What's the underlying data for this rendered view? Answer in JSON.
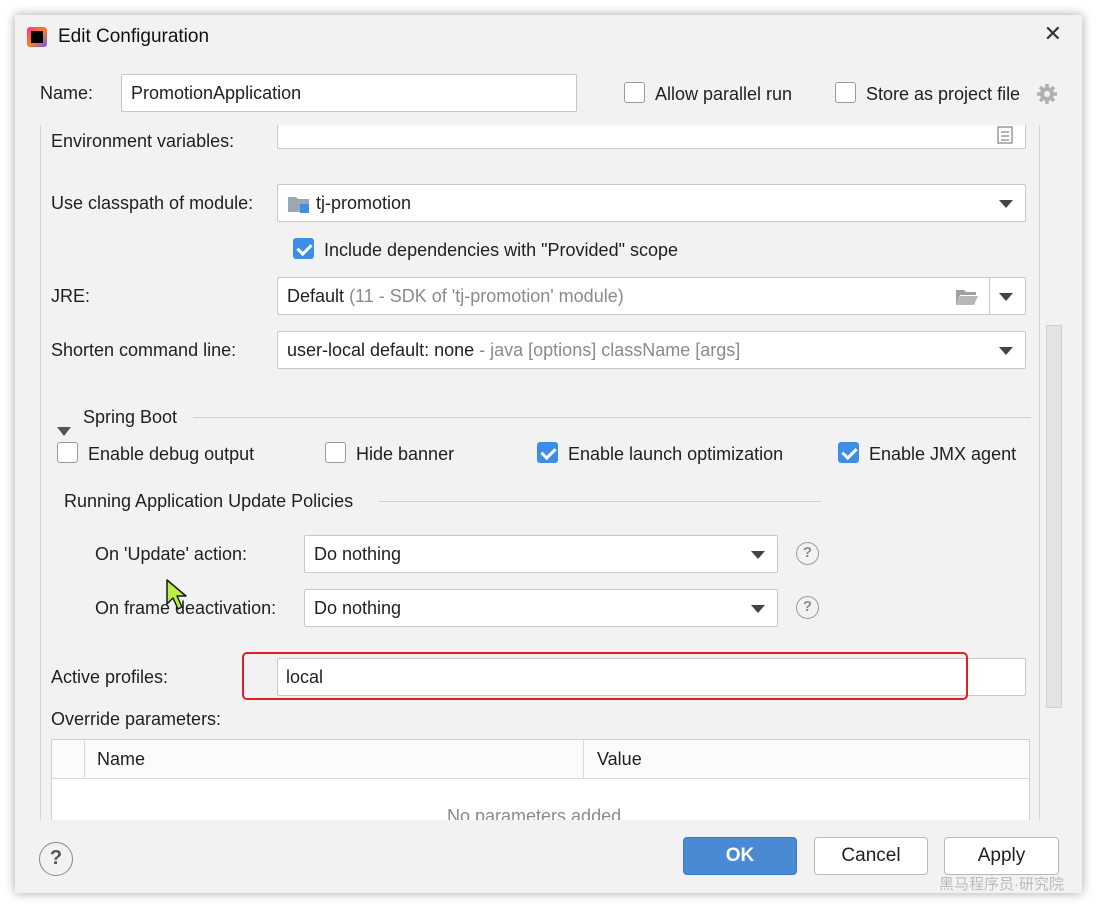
{
  "window": {
    "title": "Edit Configuration"
  },
  "name_row": {
    "label": "Name:",
    "value": "PromotionApplication",
    "allow_parallel_label": "Allow parallel run",
    "allow_parallel_checked": false,
    "store_as_file_label": "Store as project file",
    "store_as_file_checked": false
  },
  "form": {
    "env_vars": {
      "label": "Environment variables:",
      "value": ""
    },
    "classpath": {
      "label": "Use classpath of module:",
      "value": "tj-promotion"
    },
    "include_deps": {
      "label": "Include dependencies with \"Provided\" scope",
      "checked": true
    },
    "jre": {
      "label": "JRE:",
      "value": "Default",
      "hint": "(11 - SDK of 'tj-promotion' module)"
    },
    "shorten": {
      "label": "Shorten command line:",
      "value": "user-local default: none",
      "hint": "- java [options] className [args]"
    }
  },
  "spring_boot": {
    "section_title": "Spring Boot",
    "options": [
      {
        "label": "Enable debug output",
        "checked": false
      },
      {
        "label": "Hide banner",
        "checked": false
      },
      {
        "label": "Enable launch optimization",
        "checked": true
      },
      {
        "label": "Enable JMX agent",
        "checked": true
      }
    ],
    "policies_title": "Running Application Update Policies",
    "on_update": {
      "label": "On 'Update' action:",
      "value": "Do nothing"
    },
    "on_frame": {
      "label": "On frame deactivation:",
      "value": "Do nothing"
    },
    "active_profiles": {
      "label": "Active profiles:",
      "value": "local"
    },
    "override": {
      "label": "Override parameters:",
      "columns": [
        "Name",
        "Value"
      ],
      "empty_text": "No parameters added"
    }
  },
  "footer": {
    "ok": "OK",
    "cancel": "Cancel",
    "apply": "Apply"
  },
  "watermark": "黑马程序员·研究院",
  "colors": {
    "accent": "#3d8ee8",
    "highlight": "#e02020",
    "ok_button": "#4a8ad3"
  }
}
